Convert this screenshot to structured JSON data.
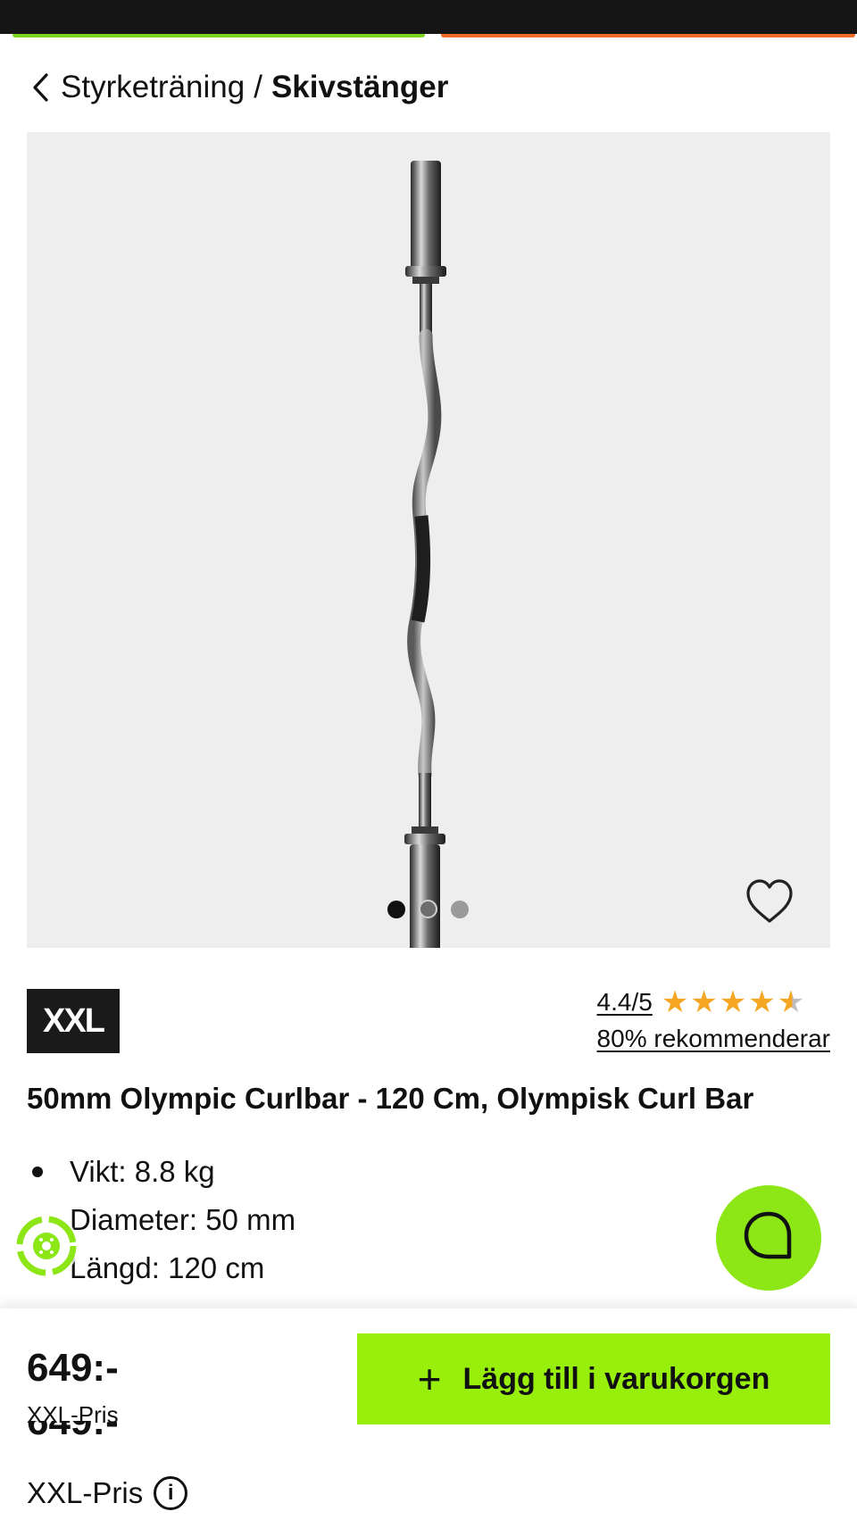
{
  "breadcrumb": {
    "parent": "Styrketräning",
    "separator": "/",
    "current": "Skivstänger"
  },
  "gallery": {
    "total_images": 3,
    "active_index": 0
  },
  "brand": {
    "logo_text": "XXL"
  },
  "rating": {
    "score": "4.4/5",
    "value": 4.4,
    "max": 5,
    "recommend": "80% rekommenderar"
  },
  "product": {
    "title": "50mm Olympic Curlbar - 120 Cm, Olympisk Curl Bar",
    "specs": [
      "Vikt: 8.8 kg",
      "Diameter: 50 mm",
      "Längd: 120 cm"
    ]
  },
  "purchase": {
    "price": "649:-",
    "price_label": "XXL-Pris",
    "add_to_cart": "Lägg till i varukorgen"
  },
  "under": {
    "price_label": "XXL-Pris",
    "info_symbol": "i"
  },
  "icons": {
    "back": "chevron-left-icon",
    "favorite": "heart-icon",
    "chat": "chat-bubble-icon",
    "add": "plus-icon",
    "info": "info-icon"
  },
  "colors": {
    "accent_green": "#99ef0c",
    "chat_green": "#8de615",
    "star": "#f5a623",
    "status_bar": "#151515"
  }
}
